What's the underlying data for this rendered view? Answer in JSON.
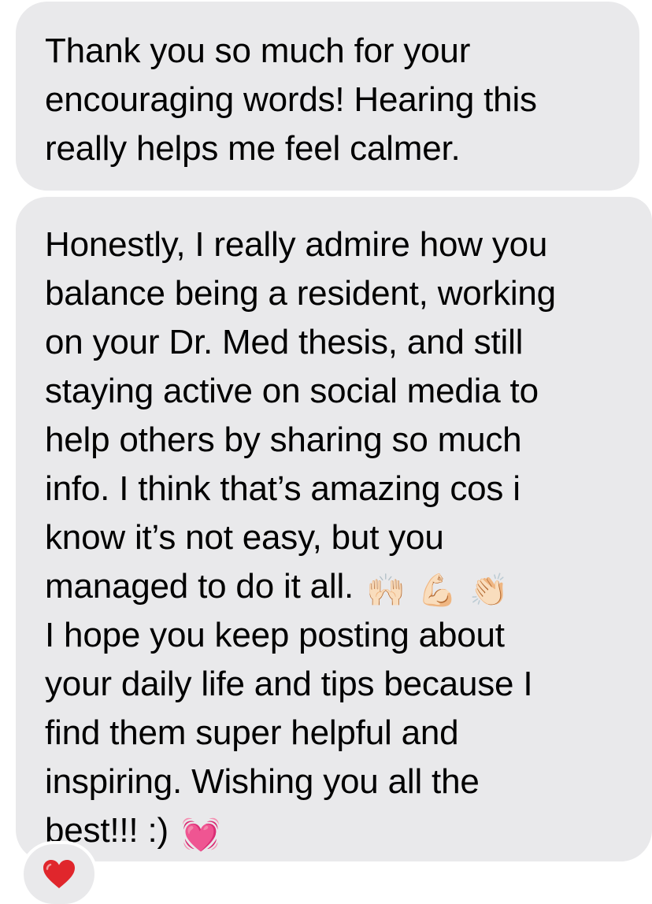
{
  "messages": [
    {
      "lines": [
        "Thank you so much for your",
        "encouraging words! Hearing this",
        "really helps me feel calmer."
      ]
    },
    {
      "lines": [
        "Honestly, I really admire how you",
        "balance being a resident, working",
        "on your Dr. Med thesis, and still",
        "staying active on social media to",
        "help others by sharing so much",
        "info. I think that’s amazing cos i",
        "know it’s not easy, but you",
        "managed to do it all.",
        "I hope you keep posting about",
        "your daily life and tips because I",
        "find them super helpful and",
        "inspiring. Wishing you all the",
        "best!!! :)"
      ],
      "emojis_line_8": [
        "🙌🏻",
        "💪🏻",
        "👏🏻"
      ],
      "emoji_last_line": "💓"
    }
  ],
  "reaction": {
    "icon": "red-heart-icon",
    "color": "#e0262c"
  }
}
